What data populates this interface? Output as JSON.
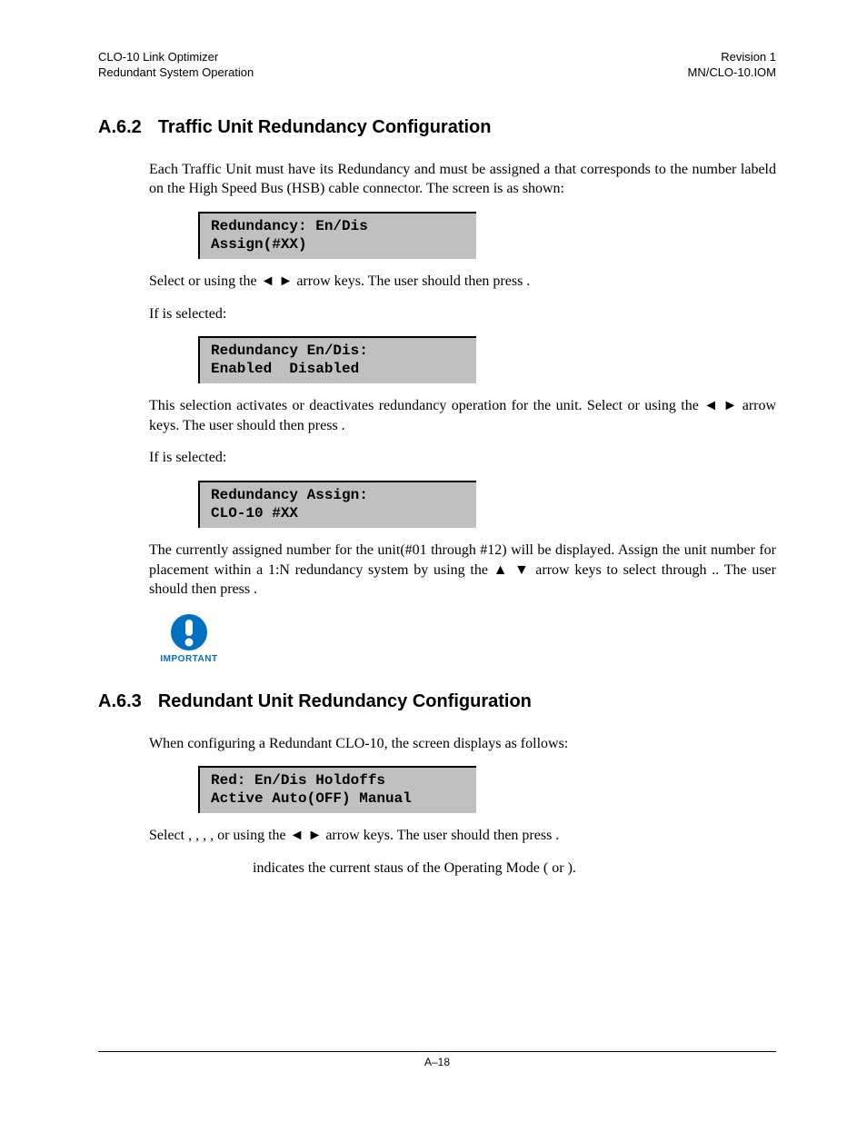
{
  "header": {
    "leftTop": "CLO-10 Link Optimizer",
    "leftBottom": "Redundant System Operation",
    "rightTop": "Revision 1",
    "rightBottom": "MN/CLO-10.IOM"
  },
  "sections": {
    "a62": {
      "num": "A.6.2",
      "title": "Traffic Unit Redundancy Configuration",
      "intro_a": "Each Traffic Unit must have its Redundancy ",
      "intro_b": " and must be assigned a ",
      "intro_c": " that corresponds to the number labeld on the High Speed Bus (HSB) cable connector. The ",
      "intro_d": " screen is as shown:",
      "screen1": "Redundancy: En/Dis\nAssign(#XX)",
      "select_a": "Select ",
      "select_b": " or ",
      "select_c": " using the ◄ ► arrow keys. The user should then press ",
      "select_d": ".",
      "if1_a": "If ",
      "if1_b": " is selected:",
      "screen2": "Redundancy En/Dis:\nEnabled  Disabled",
      "act_a": "This selection activates or deactivates redundancy operation for the unit. Select ",
      "act_b": " or ",
      "act_c": " using the ◄ ► arrow keys. The user should then press ",
      "act_d": ".",
      "if2_a": "If ",
      "if2_b": " is selected:",
      "screen3": "Redundancy Assign:\nCLO-10 #XX",
      "assign_a": "The currently assigned number for the unit(#01 through #12) will be displayed. Assign the unit number for placement within a 1:N redundancy system by using the ▲ ▼ arrow keys to select ",
      "assign_b": " through ",
      "assign_c": ".. The user should then press ",
      "assign_d": ".",
      "importantLabel": "IMPORTANT"
    },
    "a63": {
      "num": "A.6.3",
      "title": "Redundant Unit Redundancy Configuration",
      "intro_a": "When configuring a Redundant CLO-10, the ",
      "intro_b": " screen displays as follows:",
      "screen1": "Red: En/Dis Holdoffs\nActive Auto(OFF) Manual",
      "select_a": "Select ",
      "comma": ", ",
      "select_b": ", or ",
      "select_c": " using the ◄ ► arrow keys. The user should then press ",
      "select_d": ".",
      "note_a": " indicates the current staus of the Operating Mode (",
      "note_b": " or ",
      "note_c": ")."
    }
  },
  "footer": {
    "page": "A–18"
  }
}
